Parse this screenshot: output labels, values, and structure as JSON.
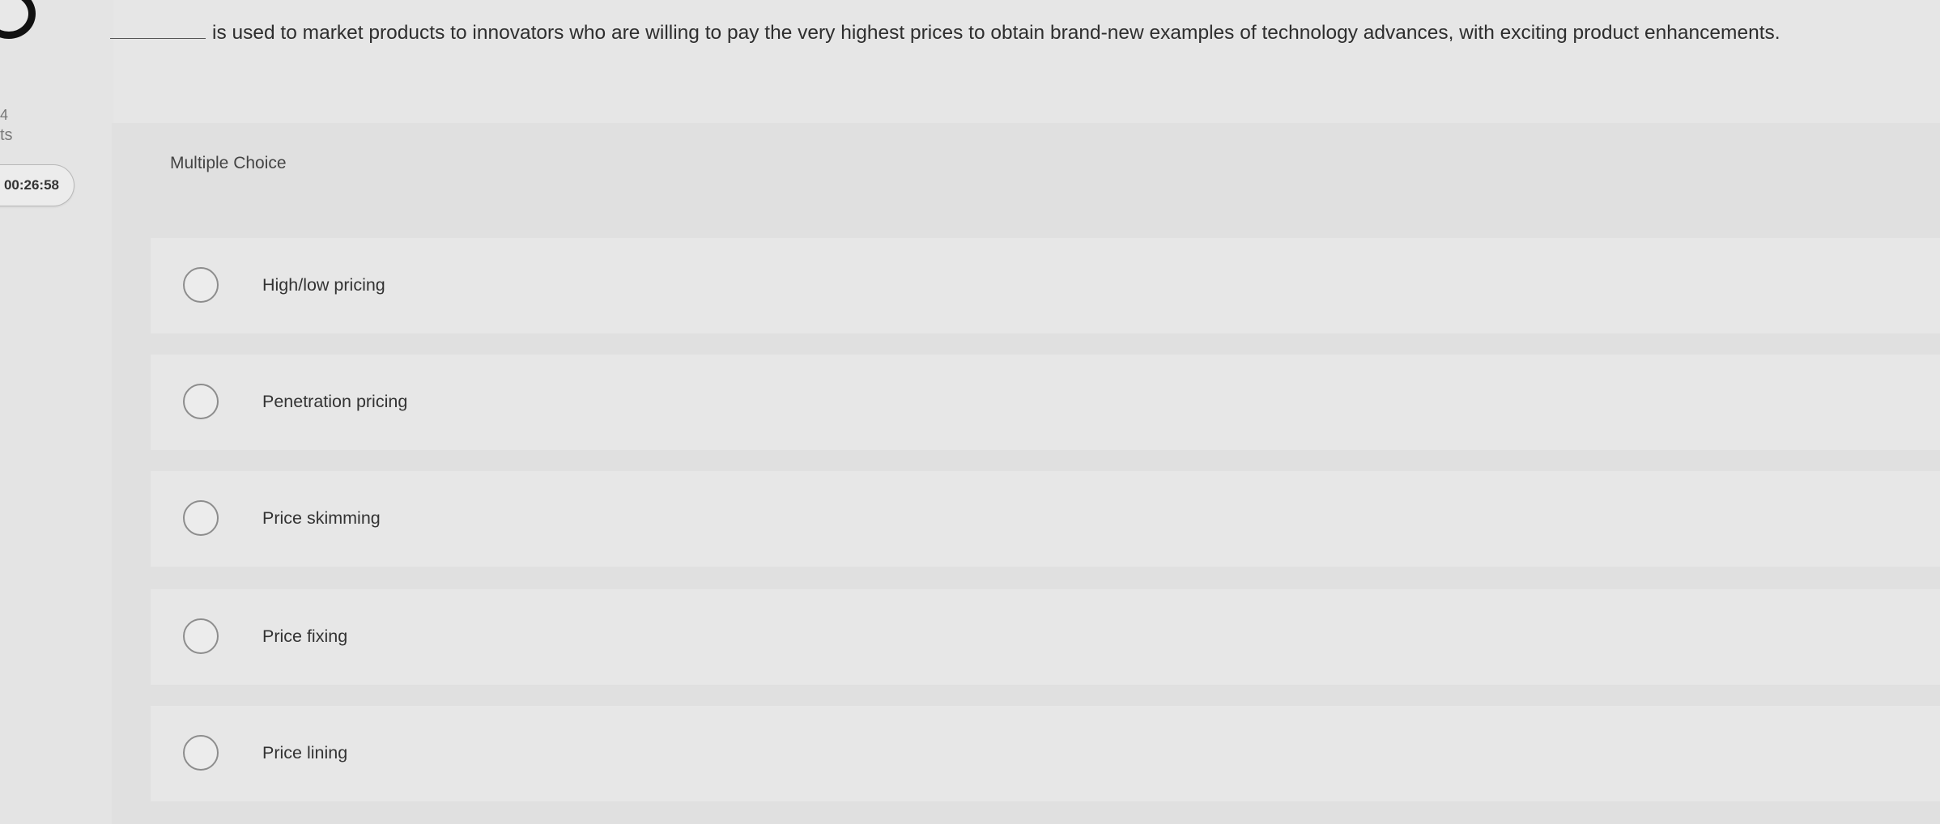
{
  "sidebar": {
    "side_mark": "4",
    "side_label": "ts",
    "timer": "00:26:58"
  },
  "question": {
    "text": "is used to market products to innovators who are willing to pay the very highest prices to obtain brand-new examples of technology advances, with exciting product enhancements."
  },
  "quiz": {
    "type_label": "Multiple Choice",
    "options": [
      {
        "label": "High/low pricing"
      },
      {
        "label": "Penetration pricing"
      },
      {
        "label": "Price skimming"
      },
      {
        "label": "Price fixing"
      },
      {
        "label": "Price lining"
      }
    ]
  }
}
